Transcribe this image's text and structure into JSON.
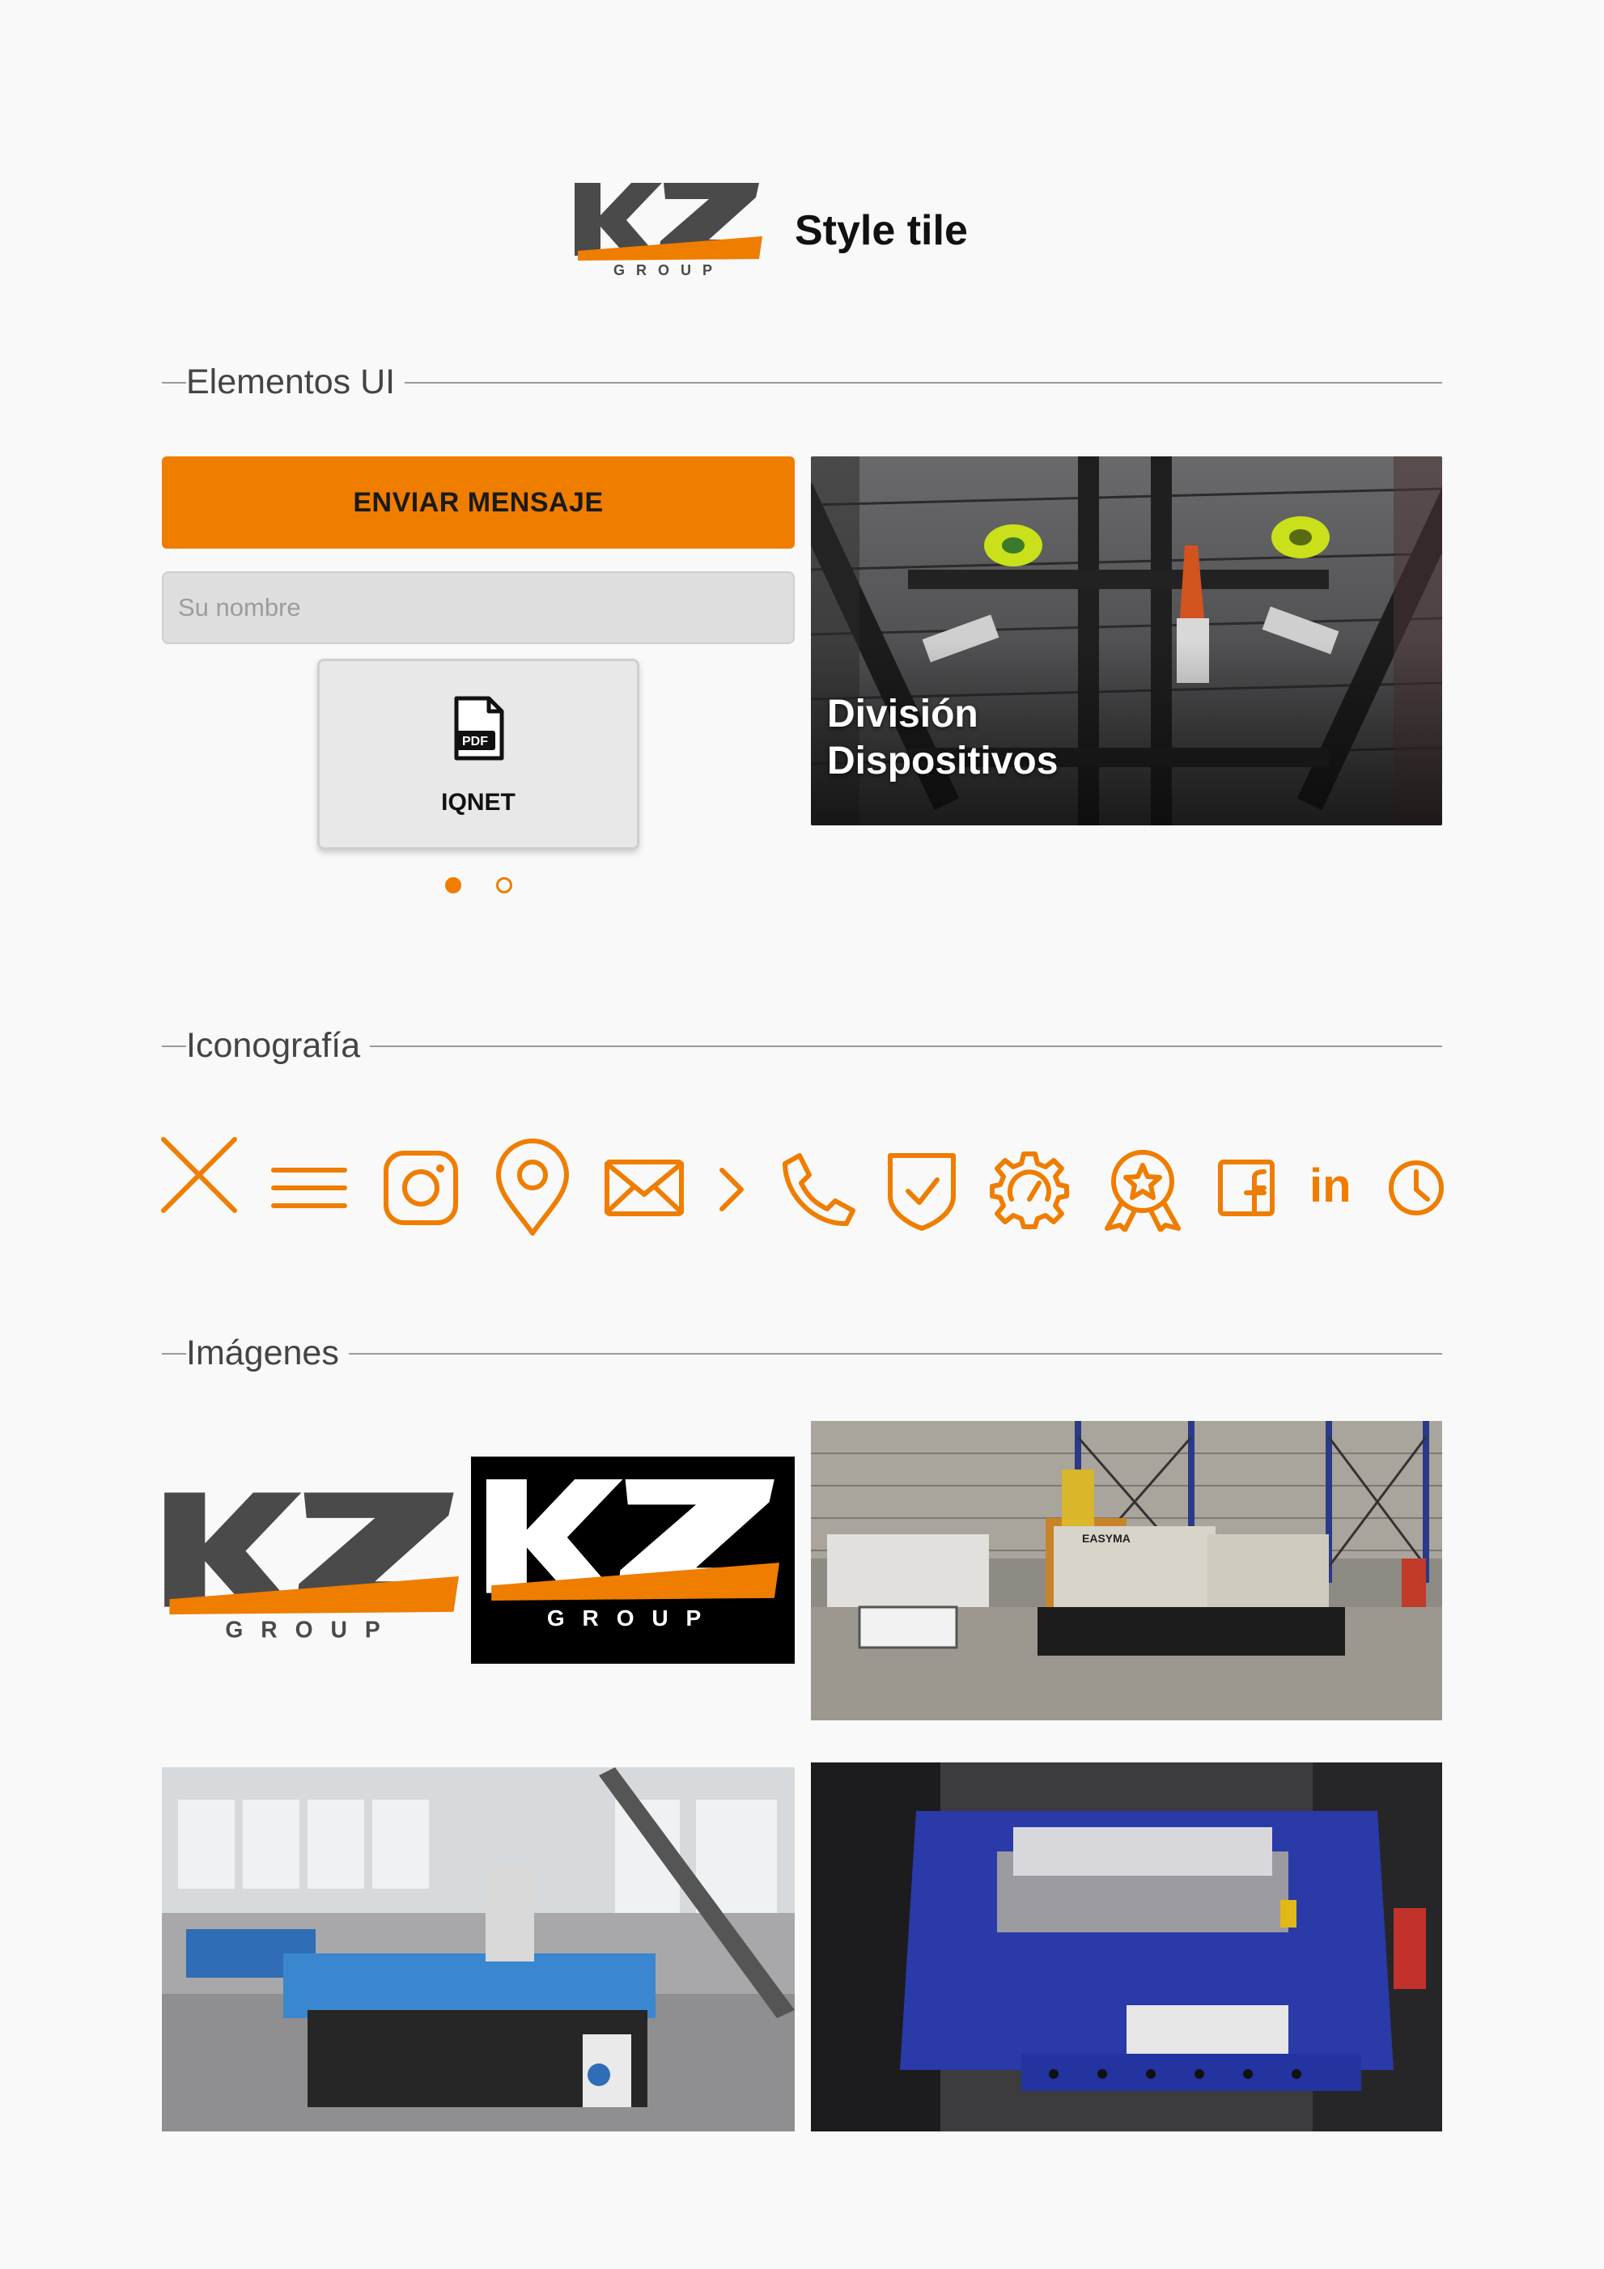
{
  "header": {
    "brand_mark": "KZ",
    "brand_sub": "GROUP",
    "title": "Style tile"
  },
  "sections": {
    "ui": "Elementos UI",
    "icons": "Iconografía",
    "images": "Imágenes"
  },
  "ui_elements": {
    "primary_button": "ENVIAR MENSAJE",
    "name_input": {
      "placeholder": "Su nombre",
      "value": ""
    },
    "file_card": {
      "badge": "PDF",
      "label": "IQNET"
    },
    "carousel": {
      "active_index": 1,
      "total": 2
    },
    "division_card": {
      "caption_line1": "División",
      "caption_line2": "Dispositivos"
    }
  },
  "icons": [
    "close-icon",
    "menu-icon",
    "instagram-icon",
    "location-pin-icon",
    "mail-icon",
    "chevron-right-icon",
    "phone-icon",
    "shield-check-icon",
    "gear-gauge-icon",
    "award-badge-icon",
    "facebook-icon",
    "linkedin-icon",
    "clock-icon"
  ],
  "icon_text": {
    "linkedin": "in"
  },
  "images": {
    "tile3_label": "EASYMA"
  },
  "colors": {
    "accent": "#ef7d00",
    "logo_gray": "#4a4a4a",
    "background": "#f9f9f9",
    "input_bg": "#dedede"
  }
}
